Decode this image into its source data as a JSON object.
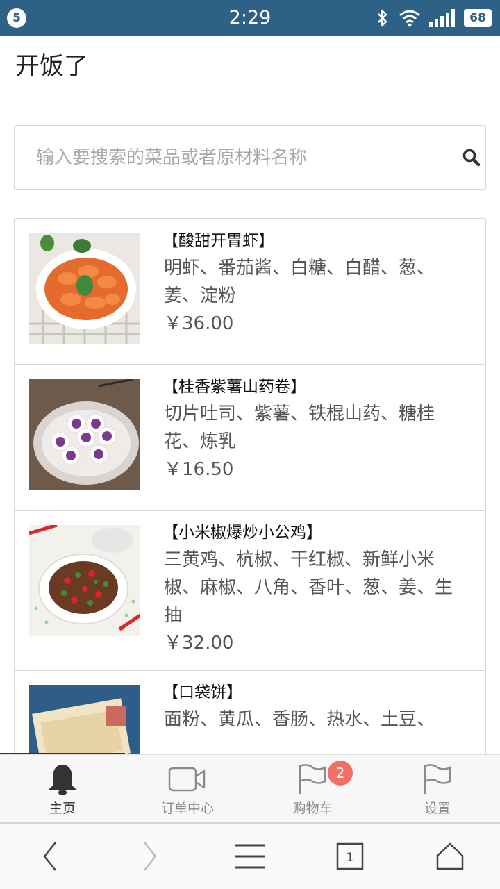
{
  "status_bar": {
    "notification_count": "5",
    "time": "2:29",
    "battery": "68",
    "icons": [
      "bluetooth-icon",
      "wifi-icon",
      "signal-icon",
      "battery-icon"
    ]
  },
  "app": {
    "title": "开饭了"
  },
  "search": {
    "placeholder": "输入要搜索的菜品或者原材料名称",
    "value": ""
  },
  "dishes": [
    {
      "name": "【酸甜开胃虾】",
      "ingredients": "明虾、番茄酱、白糖、白醋、葱、姜、淀粉",
      "price": "￥36.00"
    },
    {
      "name": "【桂香紫薯山药卷】",
      "ingredients": "切片吐司、紫薯、铁棍山药、糖桂花、炼乳",
      "price": "￥16.50"
    },
    {
      "name": "【小米椒爆炒小公鸡】",
      "ingredients": "三黄鸡、杭椒、干红椒、新鲜小米椒、麻椒、八角、香叶、葱、姜、生抽",
      "price": "￥32.00"
    },
    {
      "name": "【口袋饼】",
      "ingredients": "面粉、黄瓜、香肠、热水、土豆、",
      "price": ""
    }
  ],
  "tabs": [
    {
      "label": "主页",
      "icon": "bell-icon",
      "active": true
    },
    {
      "label": "订单中心",
      "icon": "video-camera-icon",
      "active": false
    },
    {
      "label": "购物车",
      "icon": "flag-icon",
      "badge": "2",
      "active": false
    },
    {
      "label": "设置",
      "icon": "flag-icon",
      "active": false
    }
  ],
  "browser_nav": {
    "icons": [
      "back-icon",
      "forward-icon",
      "menu-icon",
      "tabs-icon",
      "home-icon"
    ],
    "tab_count": "1"
  },
  "colors": {
    "status_bar": "#2e6186",
    "badge": "#f07068",
    "border": "#d8d8d8",
    "text_muted": "#555555"
  }
}
